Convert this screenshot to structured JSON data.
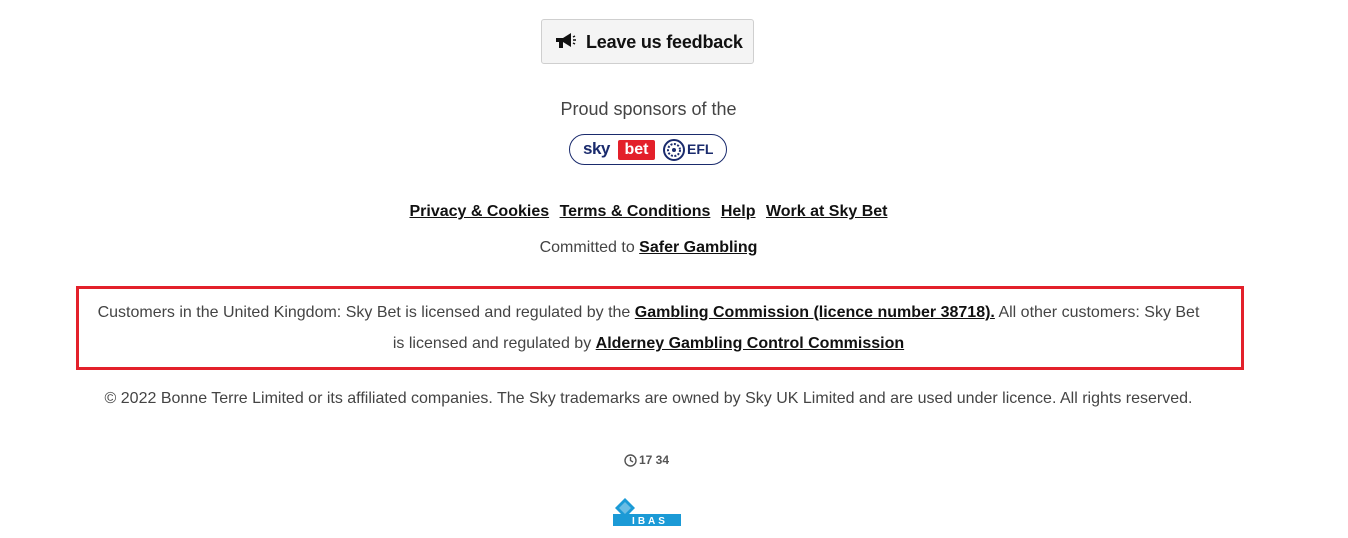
{
  "feedback": {
    "label": "Leave us feedback",
    "icon": "megaphone-icon"
  },
  "sponsor": {
    "text": "Proud sponsors of the",
    "badge_sky": "sky",
    "badge_bet": "bet",
    "badge_efl": "EFL"
  },
  "footer_links": [
    "Privacy & Cookies",
    "Terms & Conditions",
    "Help",
    "Work at Sky Bet"
  ],
  "safer": {
    "prefix": "Committed to",
    "link": "Safer Gambling"
  },
  "licence": {
    "part1": "Customers in the United Kingdom: Sky Bet is licensed and regulated by the",
    "link1": "Gambling Commission (licence number 38718).",
    "part2": "All other customers: Sky Bet is licensed and regulated by",
    "link2": "Alderney Gambling Control Commission"
  },
  "copyright": "© 2022 Bonne Terre Limited or its affiliated companies. The Sky trademarks are owned by Sky UK Limited and are used under licence. All rights reserved.",
  "time": "17 34",
  "ibas_label": "IBAS",
  "colors": {
    "highlight": "#e3202a",
    "brand_blue": "#1a2b6d",
    "ibas_blue": "#1b9ad6"
  }
}
